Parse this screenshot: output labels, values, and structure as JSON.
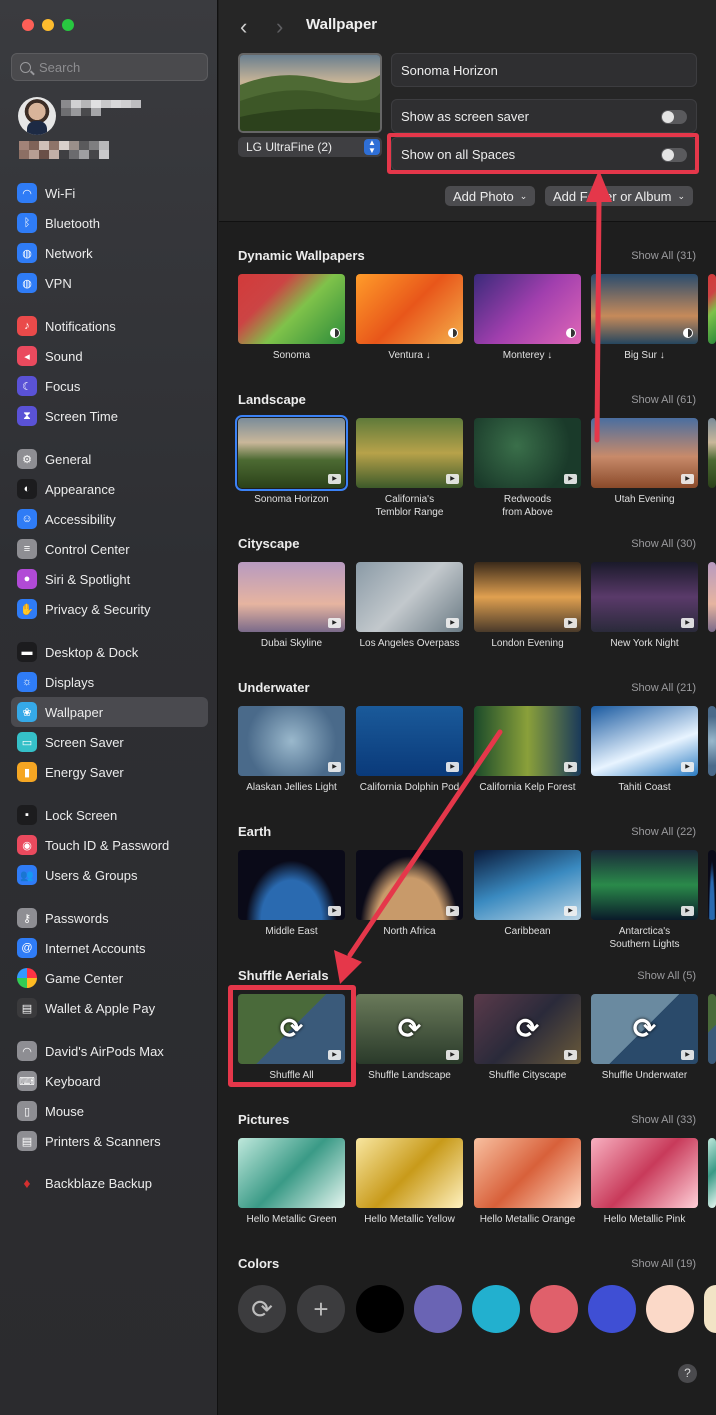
{
  "window": {
    "title": "Wallpaper"
  },
  "sidebar": {
    "search_placeholder": "Search",
    "items": [
      {
        "label": "Wi-Fi",
        "icon": "wifi-icon",
        "color": "#2f7cf6"
      },
      {
        "label": "Bluetooth",
        "icon": "bluetooth-icon",
        "color": "#2f7cf6"
      },
      {
        "label": "Network",
        "icon": "globe-icon",
        "color": "#2f7cf6"
      },
      {
        "label": "VPN",
        "icon": "vpn-icon",
        "color": "#2f7cf6"
      },
      {
        "label": "Notifications",
        "icon": "bell-icon",
        "color": "#ea4a4a"
      },
      {
        "label": "Sound",
        "icon": "speaker-icon",
        "color": "#ea4a5e"
      },
      {
        "label": "Focus",
        "icon": "moon-icon",
        "color": "#5a52d6"
      },
      {
        "label": "Screen Time",
        "icon": "hourglass-icon",
        "color": "#5a52d6"
      },
      {
        "label": "General",
        "icon": "gear-icon",
        "color": "#8e8e93"
      },
      {
        "label": "Appearance",
        "icon": "appearance-icon",
        "color": "#1c1c1e"
      },
      {
        "label": "Accessibility",
        "icon": "accessibility-icon",
        "color": "#2f7cf6"
      },
      {
        "label": "Control Center",
        "icon": "control-center-icon",
        "color": "#8e8e93"
      },
      {
        "label": "Siri & Spotlight",
        "icon": "siri-icon",
        "color": "#b14ad6"
      },
      {
        "label": "Privacy & Security",
        "icon": "hand-icon",
        "color": "#2f7cf6"
      },
      {
        "label": "Desktop & Dock",
        "icon": "dock-icon",
        "color": "#1c1c1e"
      },
      {
        "label": "Displays",
        "icon": "sun-icon",
        "color": "#2f7cf6"
      },
      {
        "label": "Wallpaper",
        "icon": "flower-icon",
        "color": "#35a9e8"
      },
      {
        "label": "Screen Saver",
        "icon": "screen-saver-icon",
        "color": "#35c0c8"
      },
      {
        "label": "Energy Saver",
        "icon": "battery-icon",
        "color": "#f5a623"
      },
      {
        "label": "Lock Screen",
        "icon": "lock-icon",
        "color": "#1c1c1e"
      },
      {
        "label": "Touch ID & Password",
        "icon": "fingerprint-icon",
        "color": "#ea4a5e"
      },
      {
        "label": "Users & Groups",
        "icon": "users-icon",
        "color": "#2f7cf6"
      },
      {
        "label": "Passwords",
        "icon": "key-icon",
        "color": "#8e8e93"
      },
      {
        "label": "Internet Accounts",
        "icon": "at-icon",
        "color": "#2f7cf6"
      },
      {
        "label": "Game Center",
        "icon": "game-center-icon",
        "color": "#e5e5e5"
      },
      {
        "label": "Wallet & Apple Pay",
        "icon": "wallet-icon",
        "color": "#3a3a3c"
      },
      {
        "label": "David's AirPods Max",
        "icon": "headphones-icon",
        "color": "#8e8e93"
      },
      {
        "label": "Keyboard",
        "icon": "keyboard-icon",
        "color": "#8e8e93"
      },
      {
        "label": "Mouse",
        "icon": "mouse-icon",
        "color": "#8e8e93"
      },
      {
        "label": "Printers & Scanners",
        "icon": "printer-icon",
        "color": "#8e8e93"
      },
      {
        "label": "Backblaze Backup",
        "icon": "flame-icon",
        "color": "#d32f2f"
      }
    ]
  },
  "header": {
    "wallpaper_name": "Sonoma Horizon",
    "display_name": "LG UltraFine (2)",
    "screen_saver_label": "Show as screen saver",
    "all_spaces_label": "Show on all Spaces",
    "add_photo_label": "Add Photo",
    "add_folder_label": "Add Folder or Album"
  },
  "sections": [
    {
      "title": "Dynamic Wallpapers",
      "show_all": "Show All (31)",
      "items": [
        "Sonoma",
        "Ventura ↓",
        "Monterey ↓",
        "Big Sur ↓"
      ]
    },
    {
      "title": "Landscape",
      "show_all": "Show All (61)",
      "items": [
        "Sonoma Horizon",
        "California's\nTemblor Range",
        "Redwoods\nfrom Above",
        "Utah Evening"
      ]
    },
    {
      "title": "Cityscape",
      "show_all": "Show All (30)",
      "items": [
        "Dubai Skyline",
        "Los Angeles Overpass",
        "London Evening",
        "New York Night"
      ]
    },
    {
      "title": "Underwater",
      "show_all": "Show All (21)",
      "items": [
        "Alaskan Jellies Light",
        "California Dolphin Pod",
        "California Kelp Forest",
        "Tahiti Coast"
      ]
    },
    {
      "title": "Earth",
      "show_all": "Show All (22)",
      "items": [
        "Middle East",
        "North Africa",
        "Caribbean",
        "Antarctica's\nSouthern Lights"
      ]
    },
    {
      "title": "Shuffle Aerials",
      "show_all": "Show All (5)",
      "items": [
        "Shuffle All",
        "Shuffle Landscape",
        "Shuffle Cityscape",
        "Shuffle Underwater"
      ]
    },
    {
      "title": "Pictures",
      "show_all": "Show All (33)",
      "items": [
        "Hello Metallic Green",
        "Hello Metallic Yellow",
        "Hello Metallic Orange",
        "Hello Metallic Pink"
      ]
    },
    {
      "title": "Colors",
      "show_all": "Show All (19)",
      "items": []
    }
  ],
  "colors": [
    "#000000",
    "#6a64b4",
    "#22b0cf",
    "#e0606b",
    "#3f4fd4",
    "#fbd9c8"
  ],
  "accent": "#e5374a"
}
